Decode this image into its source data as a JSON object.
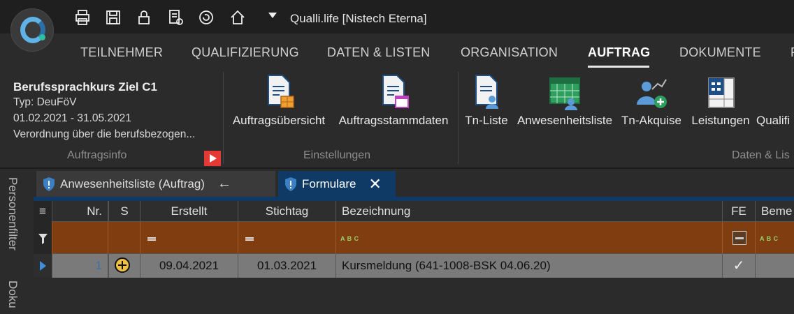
{
  "window": {
    "title": "Qualli.life [Nistech Eterna]"
  },
  "quick_access": [
    "print-icon",
    "save-icon",
    "lock-icon",
    "report-icon",
    "refresh-icon",
    "home-icon"
  ],
  "menu": {
    "items": [
      "TEILNEHMER",
      "QUALIFIZIERUNG",
      "DATEN & LISTEN",
      "ORGANISATION",
      "AUFTRAG",
      "DOKUMENTE",
      "F"
    ],
    "active": "AUFTRAG"
  },
  "ribbon": {
    "info": {
      "title": "Berufssprachkurs Ziel C1",
      "type": "Typ: DeuFöV",
      "period": "01.02.2021 - 31.05.2021",
      "description": "Verordnung über die berufsbezogen...",
      "group_label": "Auftragsinfo"
    },
    "einstellungen": {
      "group_label": "Einstellungen",
      "buttons": [
        "Auftragsübersicht",
        "Auftragsstammdaten"
      ]
    },
    "daten": {
      "group_label": "Daten & Lis",
      "buttons": [
        "Tn-Liste",
        "Anwesenheitsliste",
        "Tn-Akquise",
        "Leistungen",
        "Qualifi"
      ]
    }
  },
  "side_panels": [
    "Personenfilter",
    "Doku"
  ],
  "tabs": [
    {
      "label": "Anwesenheitsliste (Auftrag)",
      "active": false
    },
    {
      "label": "Formulare",
      "active": true
    }
  ],
  "grid": {
    "columns": [
      "Nr.",
      "S",
      "Erstellt",
      "Stichtag",
      "Bezeichnung",
      "FE",
      "Beme"
    ],
    "rows": [
      {
        "nr": "1",
        "erstellt": "09.04.2021",
        "stichtag": "01.03.2021",
        "bezeichnung": "Kursmeldung (641-1008-BSK 04.06.20)",
        "fe": "✓"
      }
    ]
  },
  "colors": {
    "accent_tab": "#0f3a66",
    "filter_row": "#7f3d10",
    "alert_red": "#e53935"
  }
}
